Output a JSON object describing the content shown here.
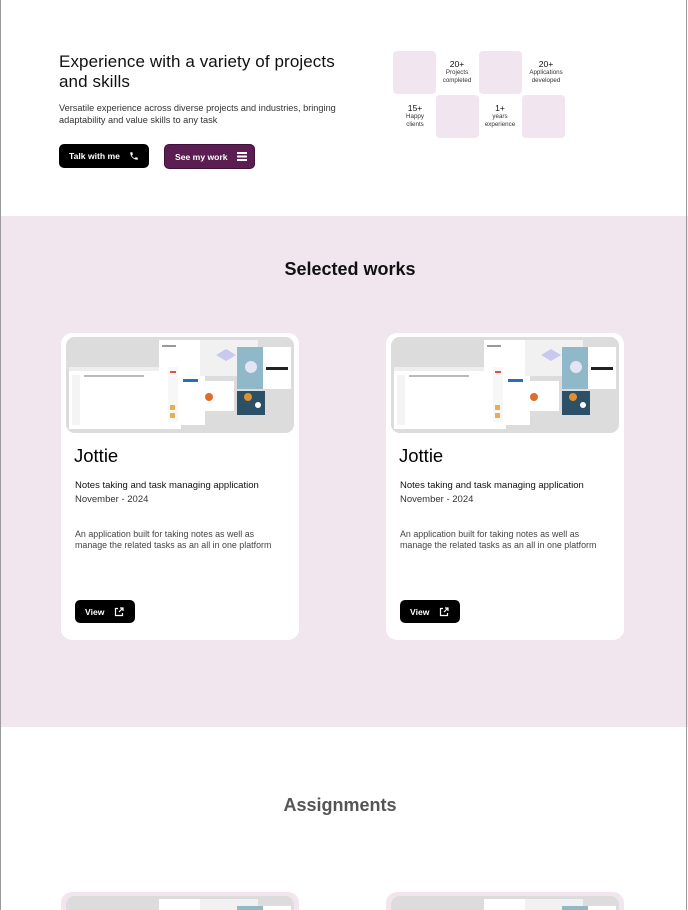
{
  "hero": {
    "title": "Experience with a variety of projects and skills",
    "subtitle": "Versatile experience across diverse projects  and industries, bringing adaptability and value skills to any task",
    "talk_button": "Talk with me",
    "talk_icon": "phone-icon",
    "work_button": "See my work",
    "work_icon": "list-icon",
    "stats": [
      {
        "number": "20+",
        "label": "Projects completed"
      },
      {
        "number": "20+",
        "label": "Applications developed"
      },
      {
        "number": "15+",
        "label": "Happy clients"
      },
      {
        "number": "1+",
        "label": "years experience"
      }
    ]
  },
  "works": {
    "title": "Selected works",
    "cards": [
      {
        "name": "Jottie",
        "subtitle": "Notes taking and task managing application",
        "date": "November - 2024",
        "description": "An application built for taking notes as well as manage the related tasks as an all in one platform",
        "button": "View",
        "button_icon": "external-link-icon"
      },
      {
        "name": "Jottie",
        "subtitle": "Notes taking and task managing application",
        "date": "November - 2024",
        "description": "An application built for taking notes as well as manage the related tasks as an all in one platform",
        "button": "View",
        "button_icon": "external-link-icon"
      }
    ]
  },
  "assignments": {
    "title": "Assignments"
  },
  "colors": {
    "accent_purple": "#5c1d52",
    "section_bg": "#f1e6ee",
    "tile_bg": "#f1e6ef",
    "button_dark": "#000000"
  }
}
